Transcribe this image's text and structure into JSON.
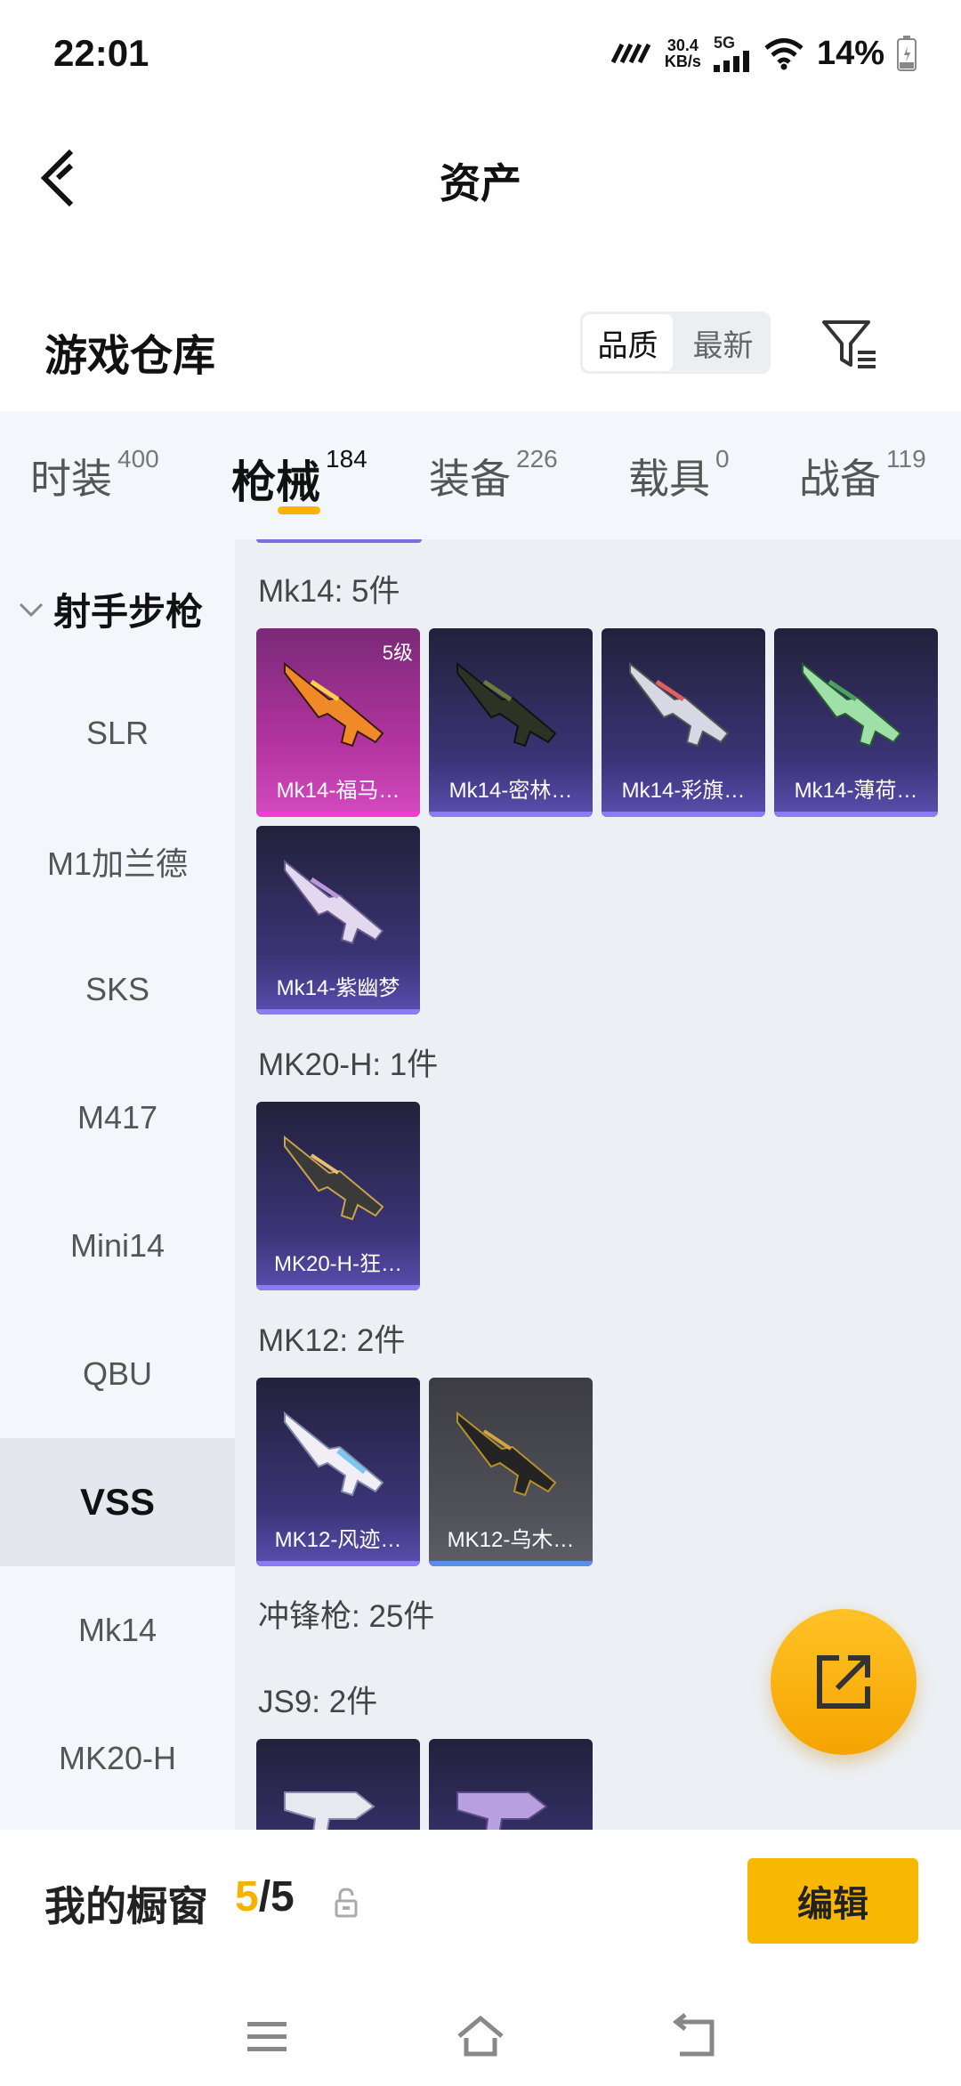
{
  "status": {
    "time": "22:01",
    "speed_value": "30.4",
    "speed_unit": "KB/s",
    "network": "5G",
    "battery": "14%"
  },
  "header": {
    "title": "资产"
  },
  "warehouse": {
    "title": "游戏仓库",
    "sort_options": [
      "品质",
      "最新"
    ],
    "active_sort": "品质"
  },
  "tabs": [
    {
      "label": "时装",
      "count": "400"
    },
    {
      "label": "枪械",
      "count": "184"
    },
    {
      "label": "装备",
      "count": "226"
    },
    {
      "label": "载具",
      "count": "0"
    },
    {
      "label": "战备",
      "count": "119"
    }
  ],
  "sidebar": {
    "group": "射手步枪",
    "items": [
      "SLR",
      "M1加兰德",
      "SKS",
      "M417",
      "Mini14",
      "QBU",
      "VSS",
      "Mk14",
      "MK20-H"
    ],
    "active": "VSS"
  },
  "sections": [
    {
      "title": "Mk14: 5件",
      "items": [
        {
          "name": "Mk14-福马…",
          "level": "5级",
          "rarity": "pink"
        },
        {
          "name": "Mk14-密林…",
          "rarity": "purple"
        },
        {
          "name": "Mk14-彩旗…",
          "rarity": "purple"
        },
        {
          "name": "Mk14-薄荷…",
          "rarity": "purple"
        },
        {
          "name": "Mk14-紫幽梦",
          "rarity": "purple"
        }
      ]
    },
    {
      "title": "MK20-H: 1件",
      "items": [
        {
          "name": "MK20-H-狂…",
          "rarity": "purple"
        }
      ]
    },
    {
      "title": "MK12: 2件",
      "items": [
        {
          "name": "MK12-风迹…",
          "rarity": "purple"
        },
        {
          "name": "MK12-乌木…",
          "rarity": "grey"
        }
      ]
    },
    {
      "title": "冲锋枪: 25件"
    },
    {
      "title": "JS9: 2件"
    }
  ],
  "showcase": {
    "label": "我的橱窗",
    "current": "5",
    "separator": "/",
    "total": "5",
    "edit_label": "编辑"
  },
  "colors": {
    "accent": "#f8b700",
    "purple_card": "#3b3477",
    "pink_card": "#b2339f",
    "grey_card": "#505058"
  },
  "icons": [
    "back-arrow-icon",
    "filter-icon",
    "chevron-down-icon",
    "lock-icon",
    "share-icon",
    "menu-icon",
    "home-icon",
    "return-icon"
  ]
}
